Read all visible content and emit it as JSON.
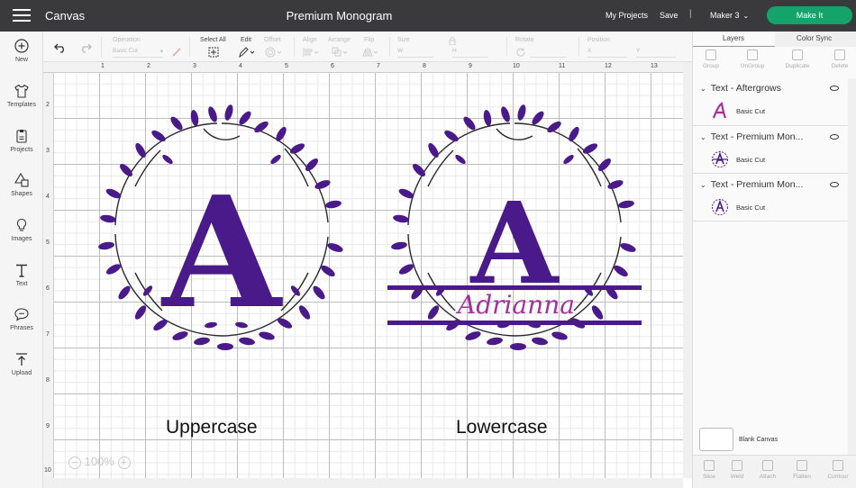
{
  "header": {
    "app_title": "Canvas",
    "doc_title": "Premium Monogram",
    "my_projects": "My Projects",
    "save": "Save",
    "separator": "|",
    "machine": "Maker 3",
    "make_it": "Make It"
  },
  "sidebar": {
    "items": [
      {
        "label": "New",
        "icon": "plus-circle-icon"
      },
      {
        "label": "Templates",
        "icon": "shirt-icon"
      },
      {
        "label": "Projects",
        "icon": "projects-icon"
      },
      {
        "label": "Shapes",
        "icon": "shapes-icon"
      },
      {
        "label": "Images",
        "icon": "lightbulb-icon"
      },
      {
        "label": "Text",
        "icon": "text-icon"
      },
      {
        "label": "Phrases",
        "icon": "speech-bubble-icon"
      },
      {
        "label": "Upload",
        "icon": "upload-icon"
      }
    ]
  },
  "toolbar": {
    "operation_label": "Operation",
    "operation_value": "Basic Cut",
    "select_all": "Select All",
    "edit": "Edit",
    "offset": "Offset",
    "align": "Align",
    "arrange": "Arrange",
    "flip": "Flip",
    "size": "Size",
    "w": "W",
    "h": "H",
    "rotate": "Rotate",
    "position": "Position",
    "x": "X",
    "y": "Y"
  },
  "ruler": {
    "top": [
      "1",
      "2",
      "3",
      "4",
      "5",
      "6",
      "7",
      "8",
      "9",
      "10",
      "11",
      "12",
      "13"
    ],
    "left": [
      "2",
      "3",
      "4",
      "5",
      "6",
      "7",
      "8",
      "9",
      "10"
    ]
  },
  "canvas": {
    "zoom": "100%",
    "zoom_minus": "−",
    "zoom_plus": "+",
    "left_letter": "A",
    "right_letter": "A",
    "script_name": "Adrianna",
    "caption_left": "Uppercase",
    "caption_right": "Lowercase",
    "purple": "#4a1a8a",
    "magenta": "#a4309c"
  },
  "panel": {
    "tabs": [
      "Layers",
      "Color Sync"
    ],
    "tools": [
      "Group",
      "UnGroup",
      "Duplicate",
      "Delete"
    ],
    "layers": [
      {
        "name": "Text - Aftergrows",
        "operation": "Basic Cut"
      },
      {
        "name": "Text - Premium Mon...",
        "operation": "Basic Cut"
      },
      {
        "name": "Text - Premium Mon...",
        "operation": "Basic Cut"
      }
    ],
    "blank_canvas": "Blank Canvas",
    "bottom_tools": [
      "Slice",
      "Weld",
      "Attach",
      "Flatten",
      "Contour"
    ]
  }
}
